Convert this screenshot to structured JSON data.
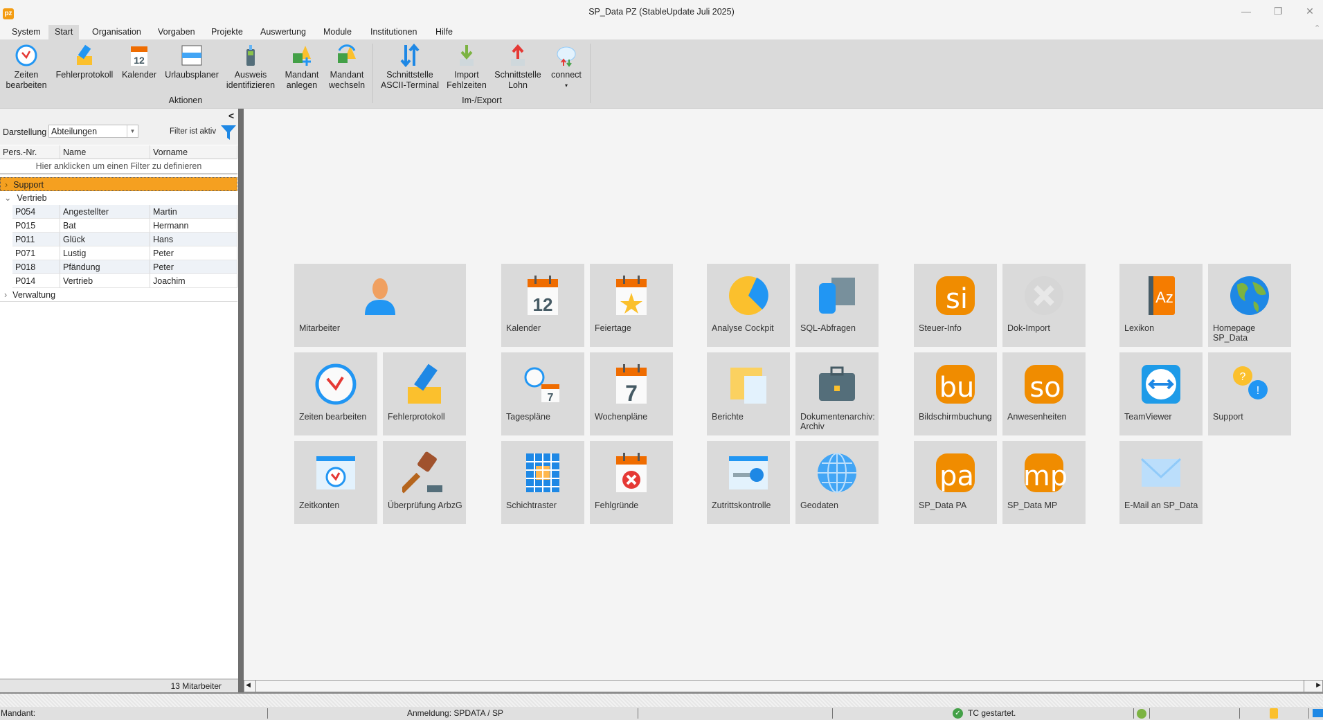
{
  "window": {
    "title": "SP_Data PZ (StableUpdate Juli 2025)",
    "app_icon": "pz"
  },
  "menu": [
    "System",
    "Start",
    "Organisation",
    "Vorgaben",
    "Projekte",
    "Auswertung",
    "Module",
    "Institutionen",
    "Hilfe"
  ],
  "ribbon": {
    "aktionen": {
      "label": "Aktionen",
      "buttons": [
        {
          "l1": "Zeiten",
          "l2": "bearbeiten"
        },
        {
          "l1": "Fehlerprotokoll",
          "l2": ""
        },
        {
          "l1": "Kalender",
          "l2": ""
        },
        {
          "l1": "Urlaubsplaner",
          "l2": ""
        },
        {
          "l1": "Ausweis",
          "l2": "identifizieren"
        },
        {
          "l1": "Mandant",
          "l2": "anlegen"
        },
        {
          "l1": "Mandant",
          "l2": "wechseln"
        }
      ]
    },
    "export": {
      "label": "Im-/Export",
      "buttons": [
        {
          "l1": "Schnittstelle",
          "l2": "ASCII-Terminal"
        },
        {
          "l1": "Import",
          "l2": "Fehlzeiten"
        },
        {
          "l1": "Schnittstelle",
          "l2": "Lohn"
        },
        {
          "l1": "connect",
          "l2": "▾"
        }
      ]
    }
  },
  "left_panel": {
    "collapse": "<",
    "darstellung_label": "Darstellung",
    "darstellung_value": "Abteilungen",
    "filter_status": "Filter ist aktiv",
    "columns": [
      "Pers.-Nr.",
      "Name",
      "Vorname"
    ],
    "filter_hint": "Hier anklicken um einen Filter zu definieren",
    "groups": [
      {
        "name": "Support",
        "expanded": false
      },
      {
        "name": "Vertrieb",
        "expanded": true
      },
      {
        "name": "Verwaltung",
        "expanded": false
      }
    ],
    "rows": [
      [
        "P054",
        "Angestellter",
        "Martin"
      ],
      [
        "P015",
        "Bat",
        "Hermann"
      ],
      [
        "P011",
        "Glück",
        "Hans"
      ],
      [
        "P071",
        "Lustig",
        "Peter"
      ],
      [
        "P018",
        "Pfändung",
        "Peter"
      ],
      [
        "P014",
        "Vertrieb",
        "Joachim"
      ]
    ],
    "footer": "13 Mitarbeiter"
  },
  "tiles": [
    "Mitarbeiter",
    "Kalender",
    "Feiertage",
    "Analyse Cockpit",
    "SQL-Abfragen",
    "Steuer-Info",
    "Dok-Import",
    "Lexikon",
    "Homepage SP_Data",
    "Zeiten bearbeiten",
    "Fehlerprotokoll",
    "Tagespläne",
    "Wochenpläne",
    "Berichte",
    "Dokumentenarchiv: Archiv",
    "Bildschirmbuchung",
    "Anwesenheiten",
    "TeamViewer",
    "Support",
    "Zeitkonten",
    "Überprüfung ArbzG",
    "Schichtraster",
    "Fehlgründe",
    "Zutrittskontrolle",
    "Geodaten",
    "SP_Data PA",
    "SP_Data MP",
    "E-Mail an SP_Data"
  ],
  "tile_icon_text": {
    "cal12": "12",
    "cal7": "7",
    "si": "si",
    "bu": "bu",
    "so": "so",
    "pa": "pa",
    "mp": "mp",
    "az": "Az"
  },
  "status": {
    "mandant": "Mandant:",
    "anmeldung": "Anmeldung:  SPDATA / SP",
    "tc": "TC gestartet."
  },
  "colors": {
    "accent": "#f39c12",
    "selected_row": "#f5a020",
    "tile": "#dadada",
    "blue": "#2196f3"
  }
}
